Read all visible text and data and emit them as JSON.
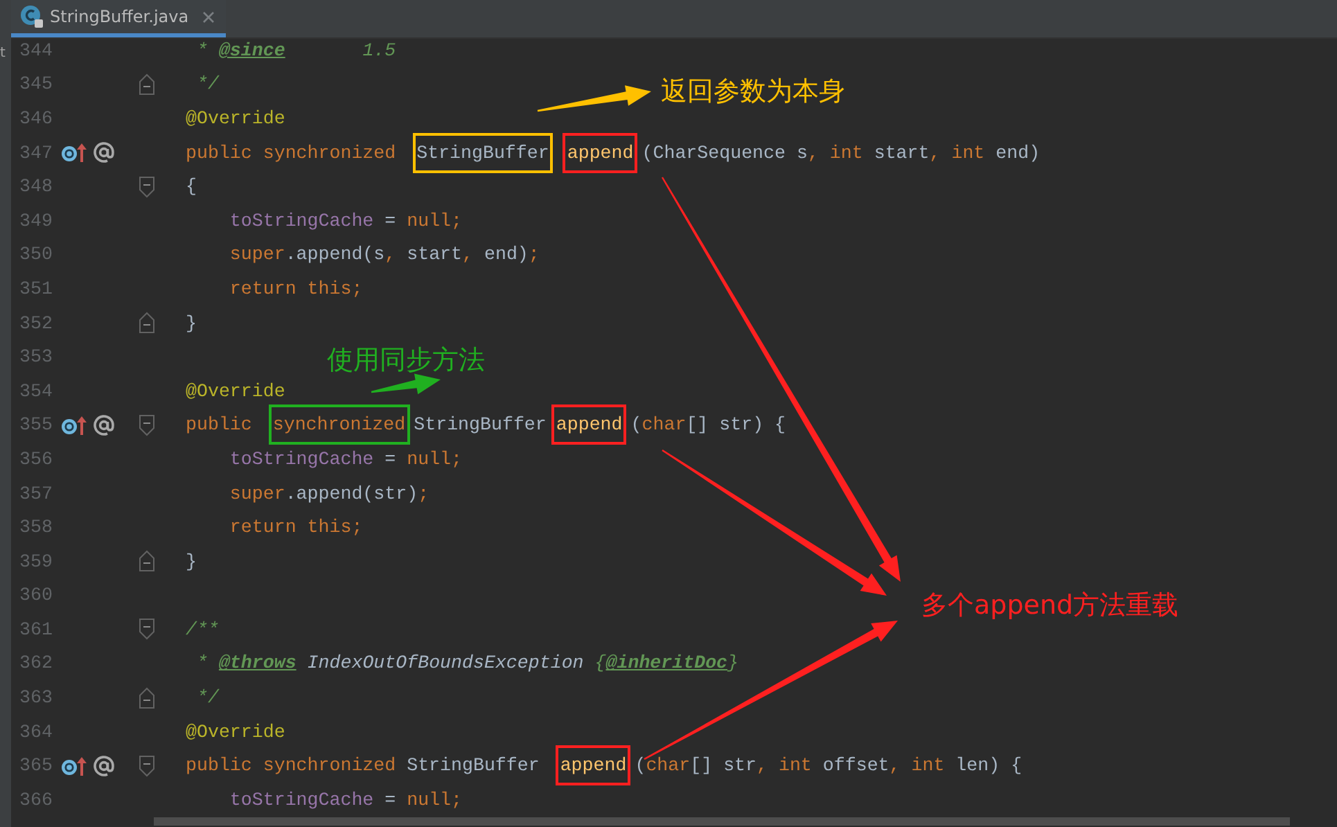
{
  "side_panel": {
    "text": "t"
  },
  "tabs": [
    {
      "label": "StringBuffer.java",
      "selected": true
    }
  ],
  "lines": [
    {
      "number": "344",
      "tokens": [
        {
          "t": " * ",
          "kind": "comment"
        },
        {
          "t": "@since",
          "kind": "doc-tag"
        },
        {
          "t": "       1.5",
          "kind": "comment"
        }
      ]
    },
    {
      "number": "345",
      "fold_end": true,
      "tokens": [
        {
          "t": " */",
          "kind": "comment"
        }
      ]
    },
    {
      "number": "346",
      "tokens": [
        {
          "t": "@Override",
          "kind": "annotation"
        }
      ]
    },
    {
      "number": "347",
      "markers": true,
      "tokens": [
        {
          "t": "public synchronized ",
          "kind": "keyword"
        },
        {
          "t": "StringBuffer",
          "kind": "plain",
          "color": "#ffc000"
        },
        {
          "t": "append",
          "kind": "method",
          "color": "#ff2020"
        },
        {
          "t": "(CharSequence s",
          "kind": "plain"
        },
        {
          "t": ", int",
          "kind": "keyword"
        },
        {
          "t": " start",
          "kind": "plain"
        },
        {
          "t": ", int",
          "kind": "keyword"
        },
        {
          "t": " end)",
          "kind": "plain"
        }
      ]
    },
    {
      "number": "348",
      "fold_start": true,
      "tokens": [
        {
          "t": "{",
          "kind": "plain"
        }
      ]
    },
    {
      "number": "349",
      "tokens": [
        {
          "t": "    toStringCache",
          "kind": "field"
        },
        {
          "t": " = ",
          "kind": "plain"
        },
        {
          "t": "null;",
          "kind": "keyword"
        }
      ]
    },
    {
      "number": "350",
      "tokens": [
        {
          "t": "    super",
          "kind": "keyword"
        },
        {
          "t": ".append(s",
          "kind": "plain"
        },
        {
          "t": ",",
          "kind": "keyword"
        },
        {
          "t": " start",
          "kind": "plain"
        },
        {
          "t": ",",
          "kind": "keyword"
        },
        {
          "t": " end)",
          "kind": "plain"
        },
        {
          "t": ";",
          "kind": "keyword"
        }
      ]
    },
    {
      "number": "351",
      "tokens": [
        {
          "t": "    return this;",
          "kind": "keyword"
        }
      ]
    },
    {
      "number": "352",
      "fold_end": true,
      "tokens": [
        {
          "t": "}",
          "kind": "plain"
        }
      ]
    },
    {
      "number": "353"
    },
    {
      "number": "354",
      "tokens": [
        {
          "t": "@Override",
          "kind": "annotation"
        }
      ]
    },
    {
      "number": "355",
      "markers": true,
      "fold_start": true,
      "tokens": [
        {
          "t": "public ",
          "kind": "keyword"
        },
        {
          "t": "synchronized",
          "kind": "keyword",
          "color": "#20b020"
        },
        {
          "t": "StringBuffer",
          "kind": "plain"
        },
        {
          "t": "append",
          "kind": "method",
          "color": "#ff2020"
        },
        {
          "t": "(",
          "kind": "plain"
        },
        {
          "t": "char",
          "kind": "keyword"
        },
        {
          "t": "[] str) {",
          "kind": "plain"
        }
      ]
    },
    {
      "number": "356",
      "tokens": [
        {
          "t": "    toStringCache",
          "kind": "field"
        },
        {
          "t": " = ",
          "kind": "plain"
        },
        {
          "t": "null;",
          "kind": "keyword"
        }
      ]
    },
    {
      "number": "357",
      "tokens": [
        {
          "t": "    super",
          "kind": "keyword"
        },
        {
          "t": ".append(str)",
          "kind": "plain"
        },
        {
          "t": ";",
          "kind": "keyword"
        }
      ]
    },
    {
      "number": "358",
      "tokens": [
        {
          "t": "    return this;",
          "kind": "keyword"
        }
      ]
    },
    {
      "number": "359",
      "fold_end": true,
      "tokens": [
        {
          "t": "}",
          "kind": "plain"
        }
      ]
    },
    {
      "number": "360"
    },
    {
      "number": "361",
      "fold_start": true,
      "tokens": [
        {
          "t": "/**",
          "kind": "comment"
        }
      ]
    },
    {
      "number": "362",
      "tokens": [
        {
          "t": " * ",
          "kind": "comment"
        },
        {
          "t": "@throws",
          "kind": "doc-tag"
        },
        {
          "t": " IndexOutOfBoundsException",
          "kind": "doc-ref"
        },
        {
          "t": " {",
          "kind": "comment"
        },
        {
          "t": "@inheritDoc",
          "kind": "doc-tag"
        },
        {
          "t": "}",
          "kind": "comment"
        }
      ]
    },
    {
      "number": "363",
      "fold_end": true,
      "tokens": [
        {
          "t": " */",
          "kind": "comment"
        }
      ]
    },
    {
      "number": "364",
      "tokens": [
        {
          "t": "@Override",
          "kind": "annotation"
        }
      ]
    },
    {
      "number": "365",
      "markers": true,
      "fold_start": true,
      "tokens": [
        {
          "t": "public synchronized ",
          "kind": "keyword"
        },
        {
          "t": "StringBuffer ",
          "kind": "plain"
        },
        {
          "t": "append",
          "kind": "method",
          "color": "#ff2020"
        },
        {
          "t": "(",
          "kind": "plain"
        },
        {
          "t": "char",
          "kind": "keyword"
        },
        {
          "t": "[] str",
          "kind": "plain"
        },
        {
          "t": ", int",
          "kind": "keyword"
        },
        {
          "t": " offset",
          "kind": "plain"
        },
        {
          "t": ", int",
          "kind": "keyword"
        },
        {
          "t": " len) {",
          "kind": "plain"
        }
      ]
    },
    {
      "number": "366",
      "tokens": [
        {
          "t": "    toStringCache",
          "kind": "field"
        },
        {
          "t": " = ",
          "kind": "plain"
        },
        {
          "t": "null;",
          "kind": "keyword"
        }
      ]
    }
  ],
  "callouts": [
    {
      "text": "返回参数为本身",
      "color": "#ffc000"
    },
    {
      "text": "使用同步方法",
      "color": "#20b020"
    },
    {
      "text": "多个append方法重载",
      "color": "#ff2020"
    }
  ]
}
